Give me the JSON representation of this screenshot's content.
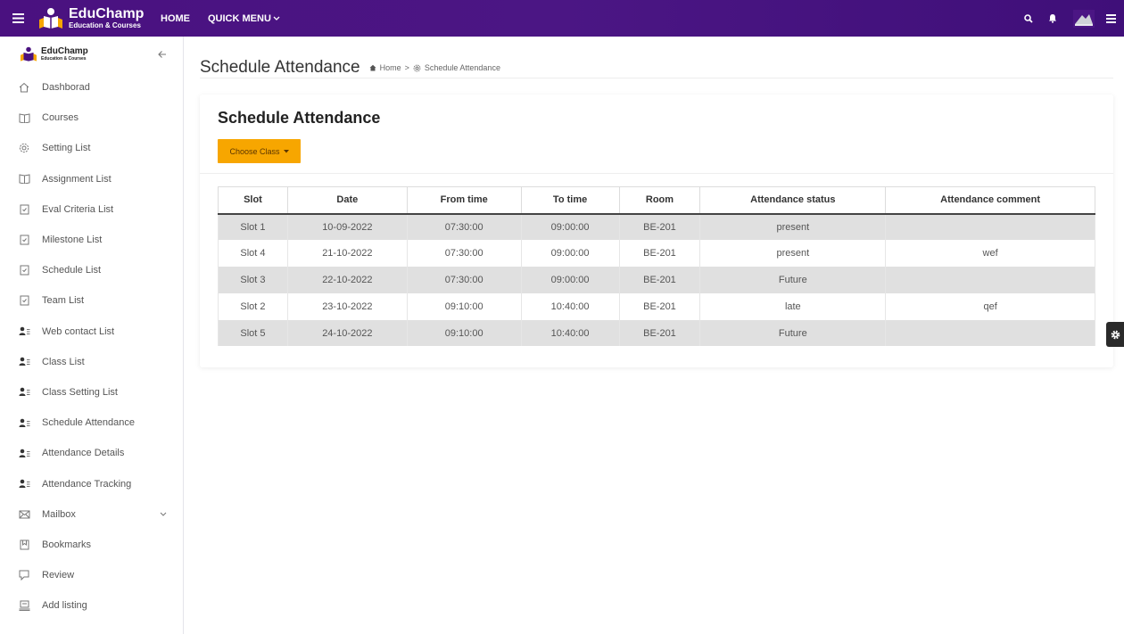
{
  "topbar": {
    "brand_name": "EduChamp",
    "brand_sub": "Education & Courses",
    "home_label": "HOME",
    "quick_menu_label": "QUICK MENU"
  },
  "sidebar": {
    "brand_name": "EduChamp",
    "brand_sub": "Education & Courses",
    "items": [
      {
        "label": "Dashborad",
        "icon": "home-icon"
      },
      {
        "label": "Courses",
        "icon": "book-icon"
      },
      {
        "label": "Setting List",
        "icon": "gear-icon"
      },
      {
        "label": "Assignment List",
        "icon": "book-icon"
      },
      {
        "label": "Eval Criteria List",
        "icon": "checkbox-icon"
      },
      {
        "label": "Milestone List",
        "icon": "checkbox-icon"
      },
      {
        "label": "Schedule List",
        "icon": "checkbox-icon"
      },
      {
        "label": "Team List",
        "icon": "checkbox-icon"
      },
      {
        "label": "Web contact List",
        "icon": "user-list-icon"
      },
      {
        "label": "Class List",
        "icon": "user-list-icon"
      },
      {
        "label": "Class Setting List",
        "icon": "user-list-icon"
      },
      {
        "label": "Schedule Attendance",
        "icon": "user-list-icon"
      },
      {
        "label": "Attendance Details",
        "icon": "user-list-icon"
      },
      {
        "label": "Attendance Tracking",
        "icon": "user-list-icon"
      },
      {
        "label": "Mailbox",
        "icon": "mail-icon"
      },
      {
        "label": "Bookmarks",
        "icon": "bookmark-icon"
      },
      {
        "label": "Review",
        "icon": "review-icon"
      },
      {
        "label": "Add listing",
        "icon": "listing-icon"
      }
    ]
  },
  "page": {
    "title": "Schedule Attendance",
    "breadcrumb_home": "Home",
    "breadcrumb_current": "Schedule Attendance"
  },
  "card": {
    "title": "Schedule Attendance",
    "choose_class_label": "Choose Class"
  },
  "table": {
    "headers": [
      "Slot",
      "Date",
      "From time",
      "To time",
      "Room",
      "Attendance status",
      "Attendance comment"
    ],
    "rows": [
      [
        "Slot 1",
        "10-09-2022",
        "07:30:00",
        "09:00:00",
        "BE-201",
        "present",
        ""
      ],
      [
        "Slot 4",
        "21-10-2022",
        "07:30:00",
        "09:00:00",
        "BE-201",
        "present",
        "wef"
      ],
      [
        "Slot 3",
        "22-10-2022",
        "07:30:00",
        "09:00:00",
        "BE-201",
        "Future",
        ""
      ],
      [
        "Slot 2",
        "23-10-2022",
        "09:10:00",
        "10:40:00",
        "BE-201",
        "late",
        "qef"
      ],
      [
        "Slot 5",
        "24-10-2022",
        "09:10:00",
        "10:40:00",
        "BE-201",
        "Future",
        ""
      ]
    ]
  },
  "colors": {
    "topbar": "#4a1180",
    "accent_button": "#f7a600",
    "row_alt": "#e0e0e0"
  }
}
